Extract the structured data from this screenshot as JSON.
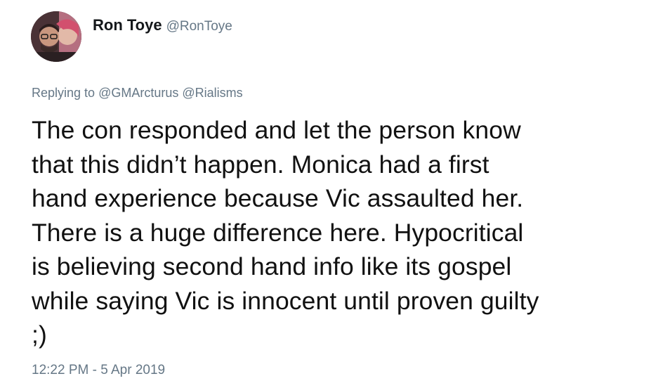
{
  "author": {
    "display_name": "Ron Toye",
    "handle": "@RonToye"
  },
  "reply": {
    "prefix": "Replying to",
    "mentions": [
      "@GMArcturus",
      "@Rialisms"
    ]
  },
  "tweet": {
    "lines": [
      "The con responded and let the person know",
      "that this didn’t happen. Monica had a first",
      "hand experience because ",
      "Vic assaulted her.",
      "There is a huge difference here. Hypocritical",
      "is believing second hand info like its gospel",
      "while saying Vic is innocent until proven guilty",
      ";)"
    ]
  },
  "timestamp": "12:22 PM - 5 Apr 2019",
  "colors": {
    "text": "#111111",
    "muted": "#657786",
    "highlight": "#f3ea3c"
  }
}
